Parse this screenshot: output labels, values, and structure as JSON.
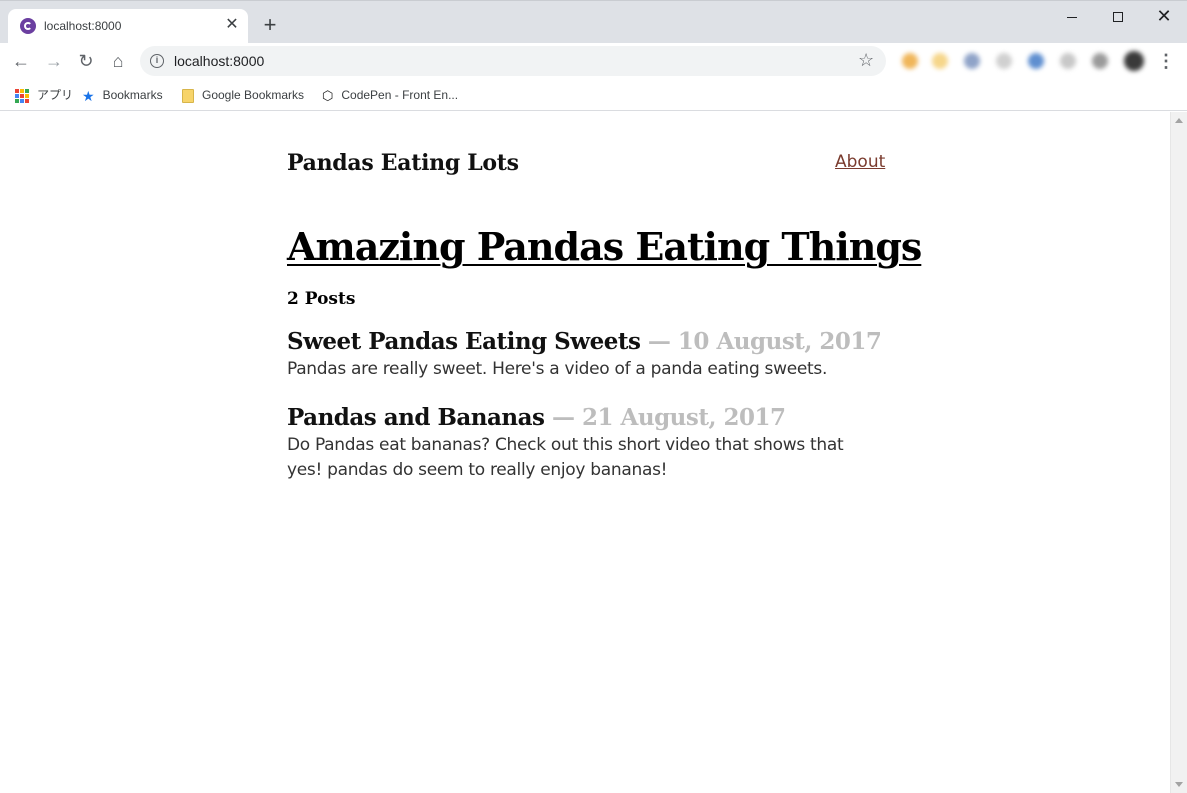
{
  "browser": {
    "tab": {
      "title": "localhost:8000"
    },
    "omnibox": {
      "url": "localhost:8000"
    },
    "bookmarks": [
      {
        "label": "アプリ",
        "icon": "apps-grid-icon"
      },
      {
        "label": "Bookmarks",
        "icon": "star-icon"
      },
      {
        "label": "Google Bookmarks",
        "icon": "folder-icon"
      },
      {
        "label": "CodePen - Front En...",
        "icon": "codepen-icon"
      }
    ]
  },
  "page": {
    "site_title": "Pandas Eating Lots",
    "nav": {
      "about_label": "About"
    },
    "heading": "Amazing Pandas Eating Things",
    "post_count": "2 Posts",
    "posts": [
      {
        "title": "Sweet Pandas Eating Sweets",
        "date": "— 10 August, 2017",
        "excerpt": "Pandas are really sweet. Here's a video of a panda eating sweets."
      },
      {
        "title": "Pandas and Bananas",
        "date": "— 21 August, 2017",
        "excerpt": "Do Pandas eat bananas? Check out this short video that shows that yes! pandas do seem to really enjoy bananas!"
      }
    ]
  },
  "colors": {
    "link": "#7a3b2e",
    "date": "#bdbdbd",
    "tabstrip": "#dee1e6"
  }
}
